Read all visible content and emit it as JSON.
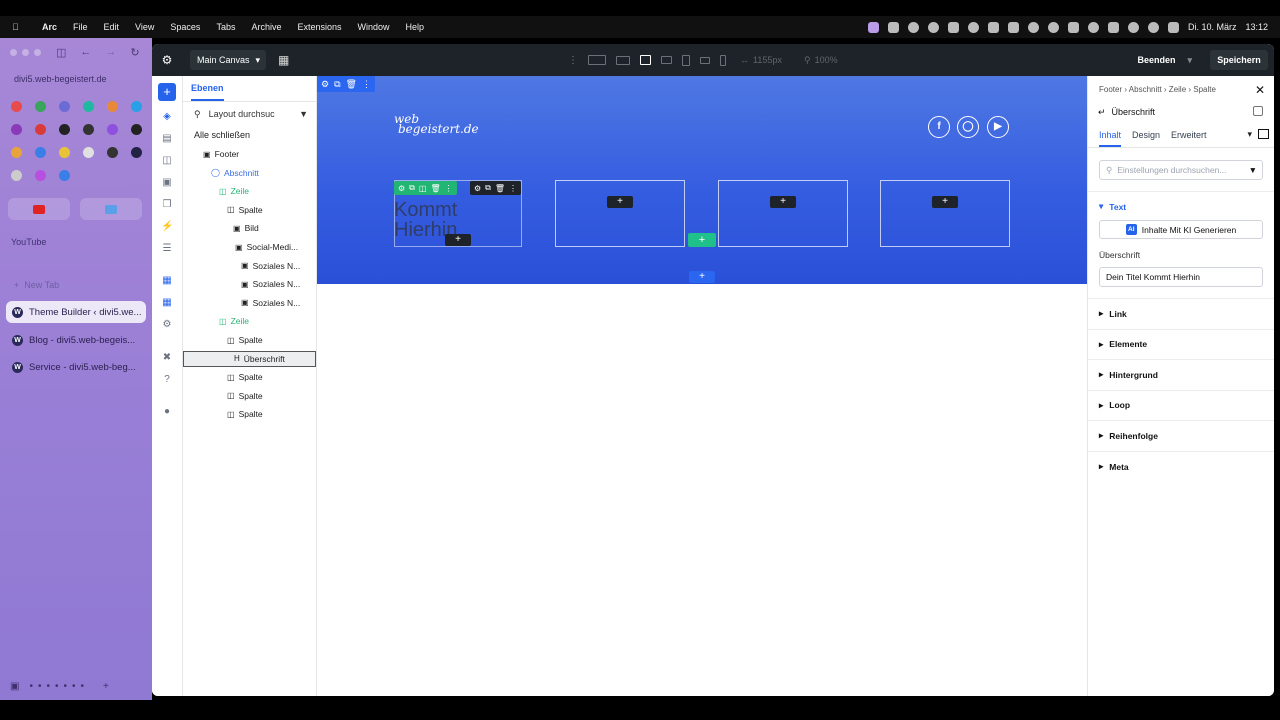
{
  "menubar": {
    "app": "Arc",
    "items": [
      "File",
      "Edit",
      "View",
      "Spaces",
      "Tabs",
      "Archive",
      "Extensions",
      "Window",
      "Help"
    ],
    "date": "Di. 10. März",
    "time": "13:12"
  },
  "arc": {
    "url": "divi5.web-begeistert.de",
    "section_label": "YouTube",
    "new_tab": "New Tab",
    "tabs": [
      {
        "label": "Theme Builder ‹ divi5.we..."
      },
      {
        "label": "Blog - divi5.web-begeis..."
      },
      {
        "label": "Service - divi5.web-beg..."
      }
    ],
    "fav_colors": [
      "#e84b4b",
      "#3aa35c",
      "#6b6bd6",
      "#20b8a0",
      "#e8893a",
      "#27a0e8",
      "#8a3ab8",
      "#d93b3b",
      "#222222",
      "#333333",
      "#8f4fe0",
      "#222222",
      "#e8a33a",
      "#3a7fe8",
      "#e8c33a",
      "#e0e0e0",
      "#333333",
      "#222244",
      "#cccccc",
      "#b84fe0",
      "#3a7fe8"
    ]
  },
  "topbar": {
    "canvas_select": "Main Canvas",
    "width_value": "1155px",
    "zoom_value": "100%",
    "exit_label": "Beenden",
    "save_label": "Speichern"
  },
  "layers": {
    "tab": "Ebenen",
    "search_placeholder": "Layout durchsuc",
    "collapse_all": "Alle schließen",
    "nodes": [
      {
        "label": "Footer",
        "type": "footer"
      },
      {
        "label": "Abschnitt",
        "type": "section"
      },
      {
        "label": "Zeile",
        "type": "row"
      },
      {
        "label": "Spalte",
        "type": "column"
      },
      {
        "label": "Bild",
        "type": "module"
      },
      {
        "label": "Social-Medi...",
        "type": "module"
      },
      {
        "label": "Soziales N...",
        "type": "module"
      },
      {
        "label": "Soziales N...",
        "type": "module"
      },
      {
        "label": "Soziales N...",
        "type": "module"
      },
      {
        "label": "Zeile",
        "type": "row"
      },
      {
        "label": "Spalte",
        "type": "column"
      },
      {
        "label": "Überschrift",
        "type": "module",
        "selected": true
      },
      {
        "label": "Spalte",
        "type": "column"
      },
      {
        "label": "Spalte",
        "type": "column"
      },
      {
        "label": "Spalte",
        "type": "column"
      }
    ]
  },
  "canvas": {
    "logo_line1": "web",
    "logo_line2": "begeistert.de",
    "heading_text": "Kommt Hierhin",
    "section_bg": "#355de0",
    "social_icons": [
      "facebook-icon",
      "instagram-icon",
      "youtube-icon"
    ]
  },
  "settings": {
    "breadcrumb": "Footer › Abschnitt › Zeile › Spalte",
    "module_title": "Überschrift",
    "tabs": [
      "Inhalt",
      "Design",
      "Erweitert"
    ],
    "search_placeholder": "Einstellungen durchsuchen...",
    "open_group": "Text",
    "ai_button": "Inhalte Mit KI Generieren",
    "ai_badge": "AI",
    "field_label": "Überschrift",
    "field_value": "Dein Titel Kommt Hierhin",
    "groups": [
      "Link",
      "Elemente",
      "Hintergrund",
      "Loop",
      "Reihenfolge",
      "Meta"
    ]
  }
}
